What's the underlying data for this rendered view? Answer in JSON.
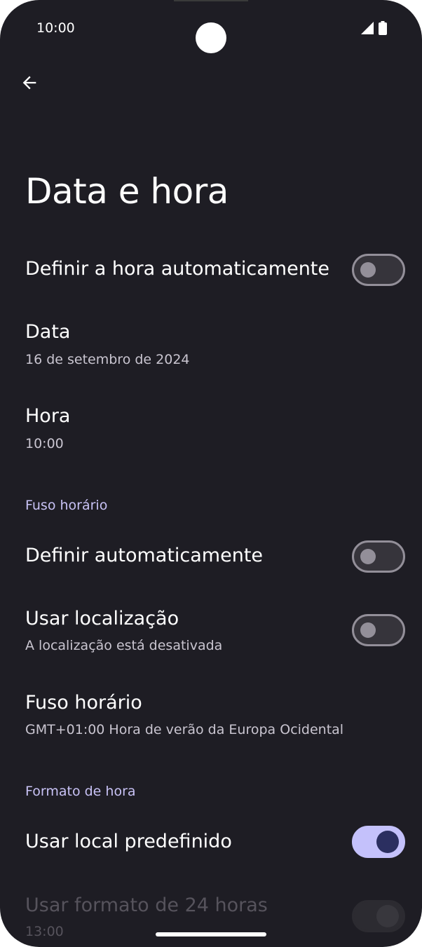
{
  "status_bar": {
    "time": "10:00",
    "icons": [
      "signal-icon",
      "battery-icon"
    ]
  },
  "header": {
    "back_icon": "arrow-back-icon",
    "title": "Data e hora"
  },
  "settings": {
    "auto_time": {
      "title": "Definir a hora automaticamente",
      "enabled": false
    },
    "date": {
      "title": "Data",
      "value": "16 de setembro de 2024"
    },
    "time": {
      "title": "Hora",
      "value": "10:00"
    },
    "timezone_section": "Fuso horário",
    "auto_timezone": {
      "title": "Definir automaticamente",
      "enabled": false
    },
    "use_location": {
      "title": "Usar localização",
      "subtitle": "A localização está desativada",
      "enabled": false
    },
    "timezone": {
      "title": "Fuso horário",
      "value": "GMT+01:00 Hora de verão da Europa Ocidental"
    },
    "format_section": "Formato de hora",
    "use_locale_default": {
      "title": "Usar local predefinido",
      "enabled": true
    },
    "use_24h": {
      "title": "Usar formato de 24 horas",
      "subtitle": "13:00",
      "enabled": true,
      "disabled": true
    }
  },
  "colors": {
    "background": "#1e1d24",
    "accent": "#c4c1fb",
    "section_header": "#c8c2f5"
  }
}
